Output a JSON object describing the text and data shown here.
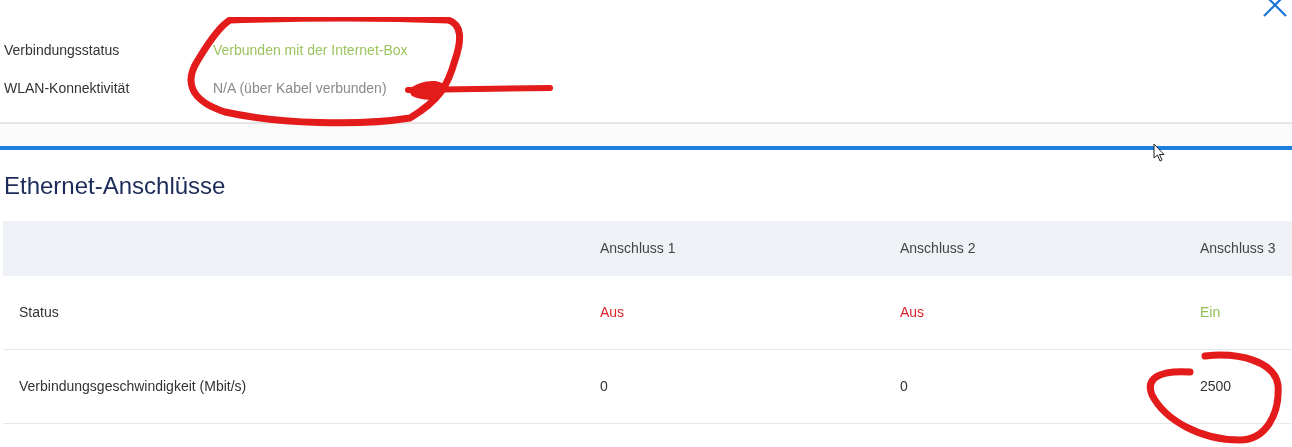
{
  "info": [
    {
      "label": "Verbindungsstatus",
      "value": "Verbunden mit der Internet-Box",
      "color": "#9cc45e"
    },
    {
      "label": "WLAN-Konnektivität",
      "value": "N/A (über Kabel verbunden)",
      "color": "#8a8a8a"
    }
  ],
  "section": {
    "title": "Ethernet-Anschlüsse"
  },
  "table": {
    "columns": [
      "Anschluss 1",
      "Anschluss 2",
      "Anschluss 3"
    ],
    "rows": [
      {
        "label": "Status",
        "kind": "status",
        "cells": [
          {
            "text": "Aus",
            "on": false
          },
          {
            "text": "Aus",
            "on": false
          },
          {
            "text": "Ein",
            "on": true
          }
        ]
      },
      {
        "label": "Verbindungsgeschwindigkeit (Mbit/s)",
        "kind": "plain",
        "cells": [
          {
            "text": "0"
          },
          {
            "text": "0"
          },
          {
            "text": "2500"
          }
        ]
      }
    ]
  }
}
